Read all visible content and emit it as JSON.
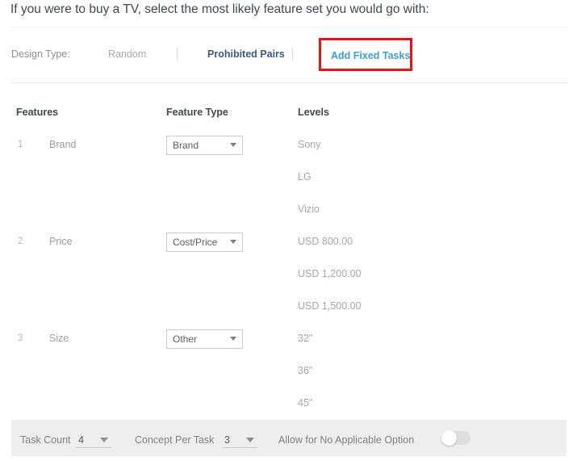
{
  "page": {
    "question": "If you were to buy a TV, select the most likely feature set you would go with:"
  },
  "toolbar": {
    "design_type_label": "Design Type:",
    "design_type_value": "Random",
    "prohibited_pairs_link": "Prohibited Pairs",
    "add_fixed_tasks_link": "Add Fixed Tasks",
    "highlight_color": "#e81313",
    "link_color": "#3b9fd6",
    "secondary_link_color": "#3d5a80"
  },
  "table": {
    "headers": {
      "features": "Features",
      "feature_type": "Feature Type",
      "levels": "Levels"
    },
    "rows": [
      {
        "index": "1",
        "feature": "Brand",
        "type": "Brand",
        "levels": [
          "Sony",
          "LG",
          "Vizio"
        ]
      },
      {
        "index": "2",
        "feature": "Price",
        "type": "Cost/Price",
        "levels": [
          "USD 800.00",
          "USD 1,200.00",
          "USD 1,500.00"
        ]
      },
      {
        "index": "3",
        "feature": "Size",
        "type": "Other",
        "levels": [
          "32\"",
          "36\"",
          "45\""
        ]
      }
    ]
  },
  "footer": {
    "task_count_label": "Task Count",
    "task_count_value": "4",
    "concept_per_task_label": "Concept Per Task",
    "concept_per_task_value": "3",
    "allow_no_applicable_label": "Allow for No Applicable Option",
    "allow_no_applicable_state": "off"
  }
}
